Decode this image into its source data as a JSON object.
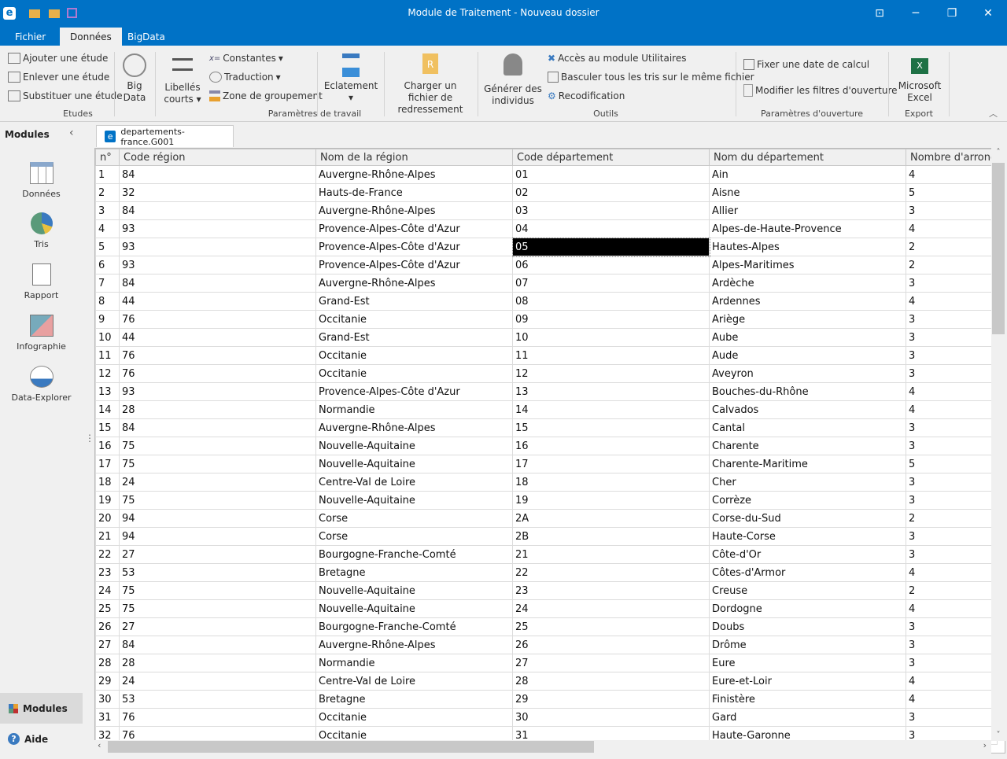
{
  "window": {
    "title": "Module de Traitement - Nouveau dossier",
    "accent": "#0072c6"
  },
  "ribbon_tabs": [
    {
      "label": "Fichier"
    },
    {
      "label": "Données",
      "active": true
    },
    {
      "label": "BigData"
    }
  ],
  "ribbon": {
    "etudes": {
      "add": "Ajouter une étude",
      "remove": "Enlever une étude",
      "replace": "Substituer une étude",
      "group": "Etudes"
    },
    "bigdata": "Big Data",
    "libelles": "Libellés courts",
    "constantes": "Constantes",
    "traduction": "Traduction",
    "zone": "Zone de groupement",
    "eclatement": "Eclatement",
    "params_group": "Paramètres de travail",
    "redressement": "Charger un fichier de redressement",
    "generer": "Générer des individus",
    "utilitaires": "Accès au module Utilitaires",
    "basculer": "Basculer tous les tris sur le même fichier",
    "recodification": "Recodification",
    "outils_group": "Outils",
    "date": "Fixer une date de calcul",
    "filtres": "Modifier les filtres d'ouverture",
    "ouverture_group": "Paramètres d'ouverture",
    "excel": "Microsoft Excel",
    "export_group": "Export"
  },
  "sidebar": {
    "title": "Modules",
    "items": [
      {
        "label": "Données",
        "icon": "grid-icon"
      },
      {
        "label": "Tris",
        "icon": "pie-chart-icon"
      },
      {
        "label": "Rapport",
        "icon": "report-icon"
      },
      {
        "label": "Infographie",
        "icon": "infographic-icon"
      },
      {
        "label": "Data-Explorer",
        "icon": "data-explorer-icon"
      }
    ],
    "bottom_modules": "Modules",
    "help": "Aide"
  },
  "document": {
    "tab": "departements-france.G001",
    "columns": [
      "n°",
      "Code région",
      "Nom de la région",
      "Code département",
      "Nom du département",
      "Nombre d'arrond"
    ],
    "selected": {
      "row": 5,
      "column": "Code département"
    },
    "rows": [
      [
        "1",
        "84",
        "Auvergne-Rhône-Alpes",
        "01",
        "Ain",
        "4"
      ],
      [
        "2",
        "32",
        "Hauts-de-France",
        "02",
        "Aisne",
        "5"
      ],
      [
        "3",
        "84",
        "Auvergne-Rhône-Alpes",
        "03",
        "Allier",
        "3"
      ],
      [
        "4",
        "93",
        "Provence-Alpes-Côte d'Azur",
        "04",
        "Alpes-de-Haute-Provence",
        "4"
      ],
      [
        "5",
        "93",
        "Provence-Alpes-Côte d'Azur",
        "05",
        "Hautes-Alpes",
        "2"
      ],
      [
        "6",
        "93",
        "Provence-Alpes-Côte d'Azur",
        "06",
        "Alpes-Maritimes",
        "2"
      ],
      [
        "7",
        "84",
        "Auvergne-Rhône-Alpes",
        "07",
        "Ardèche",
        "3"
      ],
      [
        "8",
        "44",
        "Grand-Est",
        "08",
        "Ardennes",
        "4"
      ],
      [
        "9",
        "76",
        "Occitanie",
        "09",
        "Ariège",
        "3"
      ],
      [
        "10",
        "44",
        "Grand-Est",
        "10",
        "Aube",
        "3"
      ],
      [
        "11",
        "76",
        "Occitanie",
        "11",
        "Aude",
        "3"
      ],
      [
        "12",
        "76",
        "Occitanie",
        "12",
        "Aveyron",
        "3"
      ],
      [
        "13",
        "93",
        "Provence-Alpes-Côte d'Azur",
        "13",
        "Bouches-du-Rhône",
        "4"
      ],
      [
        "14",
        "28",
        "Normandie",
        "14",
        "Calvados",
        "4"
      ],
      [
        "15",
        "84",
        "Auvergne-Rhône-Alpes",
        "15",
        "Cantal",
        "3"
      ],
      [
        "16",
        "75",
        "Nouvelle-Aquitaine",
        "16",
        "Charente",
        "3"
      ],
      [
        "17",
        "75",
        "Nouvelle-Aquitaine",
        "17",
        "Charente-Maritime",
        "5"
      ],
      [
        "18",
        "24",
        "Centre-Val de Loire",
        "18",
        "Cher",
        "3"
      ],
      [
        "19",
        "75",
        "Nouvelle-Aquitaine",
        "19",
        "Corrèze",
        "3"
      ],
      [
        "20",
        "94",
        "Corse",
        "2A",
        "Corse-du-Sud",
        "2"
      ],
      [
        "21",
        "94",
        "Corse",
        "2B",
        "Haute-Corse",
        "3"
      ],
      [
        "22",
        "27",
        "Bourgogne-Franche-Comté",
        "21",
        "Côte-d'Or",
        "3"
      ],
      [
        "23",
        "53",
        "Bretagne",
        "22",
        "Côtes-d'Armor",
        "4"
      ],
      [
        "24",
        "75",
        "Nouvelle-Aquitaine",
        "23",
        "Creuse",
        "2"
      ],
      [
        "25",
        "75",
        "Nouvelle-Aquitaine",
        "24",
        "Dordogne",
        "4"
      ],
      [
        "26",
        "27",
        "Bourgogne-Franche-Comté",
        "25",
        "Doubs",
        "3"
      ],
      [
        "27",
        "84",
        "Auvergne-Rhône-Alpes",
        "26",
        "Drôme",
        "3"
      ],
      [
        "28",
        "28",
        "Normandie",
        "27",
        "Eure",
        "3"
      ],
      [
        "29",
        "24",
        "Centre-Val de Loire",
        "28",
        "Eure-et-Loir",
        "4"
      ],
      [
        "30",
        "53",
        "Bretagne",
        "29",
        "Finistère",
        "4"
      ],
      [
        "31",
        "76",
        "Occitanie",
        "30",
        "Gard",
        "3"
      ],
      [
        "32",
        "76",
        "Occitanie",
        "31",
        "Haute-Garonne",
        "3"
      ]
    ]
  }
}
